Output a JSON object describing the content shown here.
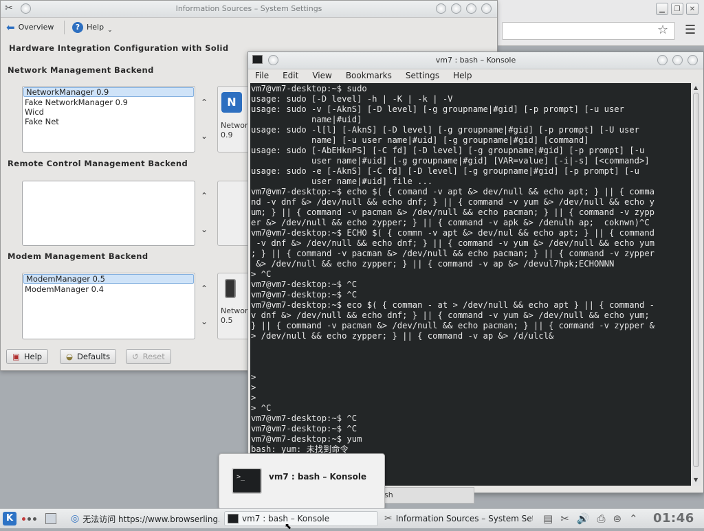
{
  "browser": {
    "star_icon": "star-icon",
    "menu_icon": "hamburger-menu-icon"
  },
  "settings_window": {
    "title": "Information Sources – System Settings",
    "toolbar": {
      "overview_label": "Overview",
      "help_label": "Help"
    },
    "page_heading": "Hardware Integration Configuration with Solid",
    "network": {
      "heading": "Network Management Backend",
      "items": [
        "NetworkManager 0.9",
        "Fake NetworkManager 0.9",
        "Wicd",
        "Fake Net"
      ],
      "selected_index": 0,
      "card_line1": "Networ",
      "card_line2": "0.9"
    },
    "remote": {
      "heading": "Remote Control Management Backend",
      "items": []
    },
    "modem": {
      "heading": "Modem Management Backend",
      "items": [
        "ModemManager 0.5",
        "ModemManager 0.4"
      ],
      "selected_index": 0,
      "card_line1": "Networ",
      "card_line2": "0.5"
    },
    "buttons": {
      "help": "Help",
      "defaults": "Defaults",
      "reset": "Reset"
    }
  },
  "konsole": {
    "title": "vm7 : bash – Konsole",
    "menu": [
      "File",
      "Edit",
      "View",
      "Bookmarks",
      "Settings",
      "Help"
    ],
    "terminal_lines": [
      "vm7@vm7-desktop:~$ sudo",
      "usage: sudo [-D level] -h | -K | -k | -V",
      "usage: sudo -v [-AknS] [-D level] [-g groupname|#gid] [-p prompt] [-u user",
      "            name|#uid]",
      "usage: sudo -l[l] [-AknS] [-D level] [-g groupname|#gid] [-p prompt] [-U user",
      "            name] [-u user name|#uid] [-g groupname|#gid] [command]",
      "usage: sudo [-AbEHknPS] [-C fd] [-D level] [-g groupname|#gid] [-p prompt] [-u",
      "            user name|#uid] [-g groupname|#gid] [VAR=value] [-i|-s] [<command>]",
      "usage: sudo -e [-AknS] [-C fd] [-D level] [-g groupname|#gid] [-p prompt] [-u",
      "            user name|#uid] file ...",
      "vm7@vm7-desktop:~$ echo $( { comand -v apt &> dev/null && echo apt; } || { comma",
      "nd -v dnf &> /dev/null && echo dnf; } || { command -v yum &> /dev/null && echo y",
      "um; } || { command -v pacman &> /dev/null && echo pacman; } || { command -v zypp",
      "er &> /dev/null && echo zypper; } || { command -v apk &> /denulh ap;  coknwn)^C",
      "vm7@vm7-desktop:~$ ECHO $( { commn -v apt &> dev/nul && echo apt; } || { command",
      " -v dnf &> /dev/null && echo dnf; } || { command -v yum &> /dev/null && echo yum",
      "; } || { command -v pacman &> /dev/null && echo pacman; } || { command -v zypper",
      " &> /dev/null && echo zypper; } || { command -v ap &> /devul7hpk;ECHONNN",
      "> ^C",
      "vm7@vm7-desktop:~$ ^C",
      "vm7@vm7-desktop:~$ ^C",
      "vm7@vm7-desktop:~$ eco $( { comman - at > /dev/null && echo apt } || { command -",
      "v dnf &> /dev/null && echo dnf; } || { command -v yum &> /dev/null && echo yum;",
      "} || { command -v pacman &> /dev/null && echo pacman; } || { command -v zypper &",
      "> /dev/null && echo zypper; } || { command -v ap &> /d/ulcl&",
      "",
      "",
      "",
      ">",
      ">",
      ">",
      "> ^C",
      "vm7@vm7-desktop:~$ ^C",
      "vm7@vm7-desktop:~$ ^C",
      "vm7@vm7-desktop:~$ yum",
      "bash: yum: 未找到命令"
    ]
  },
  "tooltip": {
    "title": "vm7 : bash – Konsole",
    "icon_text": ">_",
    "strip_text": "sh"
  },
  "panel": {
    "start_label": "K",
    "tasks": [
      {
        "label": "无法访问 https://www.browserling.c",
        "icon": "browser-icon"
      },
      {
        "label": "vm7 : bash – Konsole",
        "icon": "terminal-icon"
      },
      {
        "label": "Information Sources – System Setti",
        "icon": "settings-icon"
      }
    ],
    "clock": "01:46"
  }
}
